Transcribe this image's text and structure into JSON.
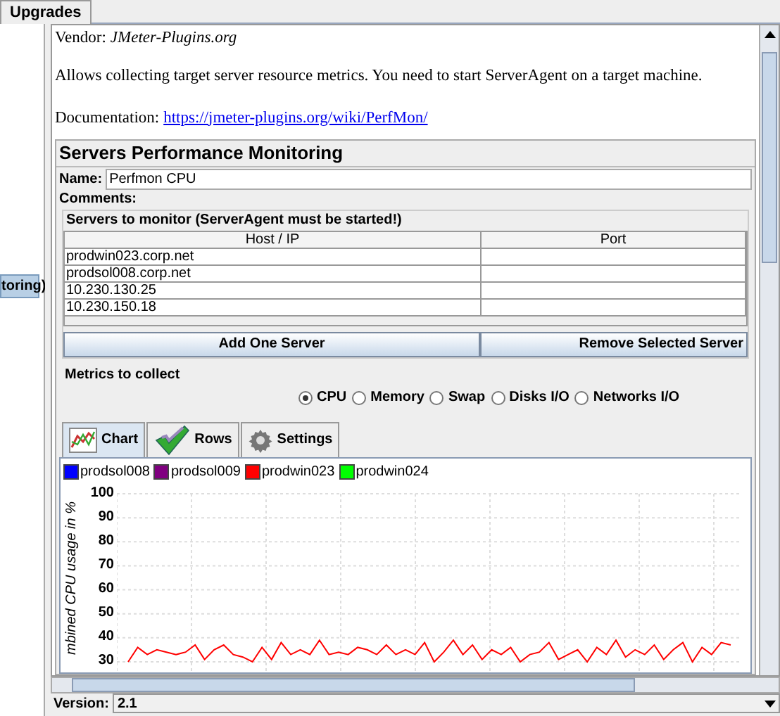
{
  "top_tabs": [
    {
      "label": "Upgrades",
      "selected": true
    }
  ],
  "side_tree": {
    "item": {
      "label": "toring)",
      "selected": true
    }
  },
  "info": {
    "vendor_label": "Vendor:",
    "vendor": "JMeter-Plugins.org",
    "description": "Allows collecting target server resource metrics. You need to start ServerAgent on a target machine.",
    "doc_label": "Documentation:",
    "doc_link": "https://jmeter-plugins.org/wiki/PerfMon/"
  },
  "title": "Servers Performance Monitoring",
  "name": {
    "label": "Name:",
    "value": "Perfmon CPU"
  },
  "comments": {
    "label": "Comments:"
  },
  "servers": {
    "title": "Servers to monitor (ServerAgent must be started!)",
    "columns": [
      "Host / IP",
      "Port"
    ],
    "rows": [
      [
        "prodwin023.corp.net",
        ""
      ],
      [
        "prodsol008.corp.net",
        ""
      ],
      [
        "10.230.130.25",
        ""
      ],
      [
        "10.230.150.18",
        ""
      ]
    ],
    "buttons": [
      "Add One Server",
      "Remove Selected Server"
    ]
  },
  "metrics": {
    "title": "Metrics to collect",
    "options": [
      {
        "label": "CPU",
        "selected": true
      },
      {
        "label": "Memory",
        "selected": false
      },
      {
        "label": "Swap",
        "selected": false
      },
      {
        "label": "Disks I/O",
        "selected": false
      },
      {
        "label": "Networks I/O",
        "selected": false
      }
    ]
  },
  "view_tabs": [
    {
      "label": "Chart",
      "kind": "chart",
      "selected": true
    },
    {
      "label": "Rows",
      "kind": "rows",
      "selected": false
    },
    {
      "label": "Settings",
      "kind": "settings",
      "selected": false
    }
  ],
  "chart_data": {
    "type": "line",
    "ylabel": "mbined CPU usage in %",
    "ylim": [
      25,
      100
    ],
    "yticks": [
      30,
      40,
      50,
      60,
      70,
      80,
      90,
      100
    ],
    "grid": true,
    "series": [
      {
        "name": "prodsol008",
        "color": "#0000ff",
        "values": [
          null,
          null,
          null,
          null,
          null,
          null,
          null,
          null,
          null,
          null,
          null,
          null,
          null,
          null,
          null,
          null,
          null,
          null,
          null,
          null,
          null,
          null,
          null,
          null,
          null,
          null,
          null,
          null,
          null,
          null,
          null,
          null,
          null,
          null,
          null,
          null,
          null,
          null,
          null,
          null,
          null,
          null,
          null,
          null,
          null,
          null,
          null,
          null,
          null,
          null,
          null,
          null,
          null,
          null,
          null,
          null,
          null,
          null,
          null,
          null,
          null,
          null,
          null,
          null
        ]
      },
      {
        "name": "prodsol009",
        "color": "#800080",
        "values": [
          null,
          null,
          null,
          null,
          null,
          null,
          null,
          null,
          null,
          null,
          null,
          null,
          null,
          null,
          null,
          null,
          null,
          null,
          null,
          null,
          null,
          null,
          null,
          null,
          null,
          null,
          null,
          null,
          null,
          null,
          null,
          null,
          null,
          null,
          null,
          null,
          null,
          null,
          null,
          null,
          null,
          null,
          null,
          null,
          null,
          null,
          null,
          null,
          null,
          null,
          null,
          null,
          null,
          null,
          null,
          null,
          null,
          null,
          null,
          null,
          null,
          null,
          null,
          null
        ]
      },
      {
        "name": "prodwin023",
        "color": "#ff0000",
        "values": [
          30,
          36,
          33,
          35,
          34,
          33,
          34,
          37,
          31,
          35,
          37,
          33,
          32,
          30,
          36,
          31,
          38,
          33,
          35,
          33,
          39,
          33,
          34,
          33,
          36,
          35,
          33,
          37,
          33,
          35,
          33,
          38,
          30,
          34,
          39,
          33,
          37,
          31,
          35,
          33,
          36,
          30,
          33,
          34,
          38,
          31,
          33,
          35,
          30,
          36,
          33,
          39,
          32,
          35,
          33,
          37,
          31,
          35,
          38,
          30,
          36,
          33,
          38,
          37
        ]
      },
      {
        "name": "prodwin024",
        "color": "#00ff00",
        "values": [
          null,
          null,
          null,
          null,
          null,
          null,
          null,
          null,
          null,
          null,
          null,
          null,
          null,
          null,
          null,
          null,
          null,
          null,
          null,
          null,
          null,
          null,
          null,
          null,
          null,
          null,
          null,
          null,
          null,
          null,
          null,
          null,
          null,
          null,
          null,
          null,
          null,
          null,
          null,
          null,
          null,
          null,
          null,
          null,
          null,
          null,
          null,
          null,
          null,
          null,
          null,
          null,
          null,
          null,
          null,
          null,
          null,
          null,
          null,
          null,
          null,
          null,
          null,
          null
        ]
      }
    ]
  },
  "version": {
    "label": "Version:",
    "value": "2.1"
  }
}
